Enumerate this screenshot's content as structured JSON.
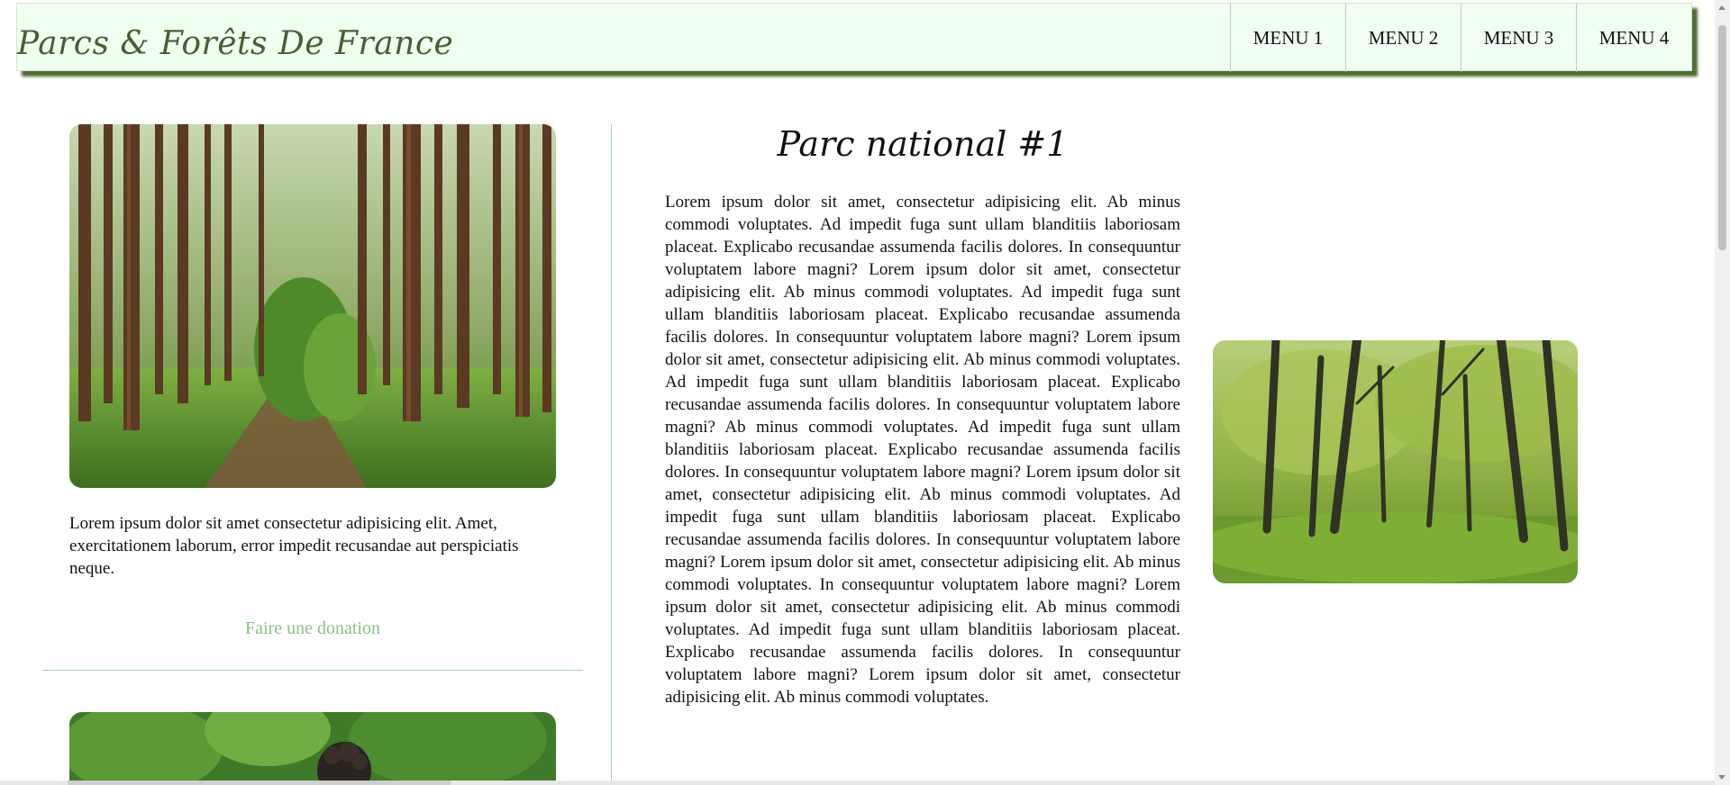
{
  "header": {
    "site_title": "Parcs & Forêts De France",
    "menu": [
      "MENU 1",
      "MENU 2",
      "MENU 3",
      "MENU 4"
    ]
  },
  "sidebar": {
    "description": "Lorem ipsum dolor sit amet consectetur adipisicing elit. Amet, exercitationem laborum, error impedit recusandae aut perspiciatis neque.",
    "donate_label": "Faire une donation"
  },
  "main": {
    "title": "Parc national #1",
    "body": "Lorem ipsum dolor sit amet, consectetur adipisicing elit. Ab minus commodi voluptates. Ad impedit fuga sunt ullam blanditiis laboriosam placeat. Explicabo recusandae assumenda facilis dolores. In consequuntur voluptatem labore magni? Lorem ipsum dolor sit amet, consectetur adipisicing elit. Ab minus commodi voluptates. Ad impedit fuga sunt ullam blanditiis laboriosam placeat. Explicabo recusandae assumenda facilis dolores. In consequuntur voluptatem labore magni? Lorem ipsum dolor sit amet, consectetur adipisicing elit. Ab minus commodi voluptates. Ad impedit fuga sunt ullam blanditiis laboriosam placeat. Explicabo recusandae assumenda facilis dolores. In consequuntur voluptatem labore magni? Ab minus commodi voluptates. Ad impedit fuga sunt ullam blanditiis laboriosam placeat. Explicabo recusandae assumenda facilis dolores. In consequuntur voluptatem labore magni? Lorem ipsum dolor sit amet, consectetur adipisicing elit. Ab minus commodi voluptates. Ad impedit fuga sunt ullam blanditiis laboriosam placeat. Explicabo recusandae assumenda facilis dolores. In consequuntur voluptatem labore magni? Lorem ipsum dolor sit amet, consectetur adipisicing elit. Ab minus commodi voluptates. In consequuntur voluptatem labore magni? Lorem ipsum dolor sit amet, consectetur adipisicing elit. Ab minus commodi voluptates. Ad impedit fuga sunt ullam blanditiis laboriosam placeat. Explicabo recusandae assumenda facilis dolores. In consequuntur voluptatem labore magni? Lorem ipsum dolor sit amet, consectetur adipisicing elit. Ab minus commodi voluptates."
  },
  "colors": {
    "header_bg": "#f0fff0",
    "header_shadow": "#4d6b33",
    "accent_green": "#8abf8a",
    "divider_green": "#a7cfa7",
    "title_green": "#4a5d35"
  }
}
